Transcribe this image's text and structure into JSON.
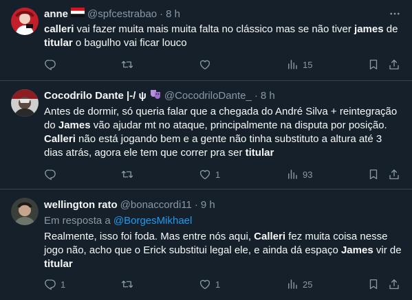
{
  "tweets": [
    {
      "name": "anne",
      "handle": "@spfcestrabao",
      "sep": "·",
      "time": "8 h",
      "text_parts": [
        {
          "t": "calleri",
          "b": true
        },
        {
          "t": " vai fazer muita mais muita falta no clássico mas se não tiver ",
          "b": false
        },
        {
          "t": "james",
          "b": true
        },
        {
          "t": " de ",
          "b": false
        },
        {
          "t": "titular",
          "b": true
        },
        {
          "t": " o bagulho vai ficar louco",
          "b": false
        }
      ],
      "replies": "",
      "retweets": "",
      "likes": "",
      "views": "15"
    },
    {
      "name": "Cocodrilo Dante |-/ ψ",
      "handle": "@CocodriloDante_",
      "sep": "·",
      "time": "8 h",
      "text_parts": [
        {
          "t": "Antes de dormir, só queria falar que a chegada do André Silva + reintegração do ",
          "b": false
        },
        {
          "t": "James",
          "b": true
        },
        {
          "t": " vão ajudar mt no ataque, principalmente na disputa por posição. ",
          "b": false
        },
        {
          "t": "Calleri",
          "b": true
        },
        {
          "t": " não está jogando bem e a gente não tinha substituto a altura até 3 dias atrás, agora ele tem que correr pra ser ",
          "b": false
        },
        {
          "t": "titular",
          "b": true
        }
      ],
      "replies": "",
      "retweets": "",
      "likes": "1",
      "views": "93"
    },
    {
      "name": "wellington rato",
      "handle": "@bonaccordi11",
      "sep": "·",
      "time": "9 h",
      "reply_prefix": "Em resposta a",
      "reply_to": "@BorgesMikhael",
      "text_parts": [
        {
          "t": "Realmente, isso foi foda. Mas entre nós aqui, ",
          "b": false
        },
        {
          "t": "Calleri",
          "b": true
        },
        {
          "t": " fez muita coisa nesse jogo não, acho que o Erick substitui legal ele, e ainda dá espaço ",
          "b": false
        },
        {
          "t": "James",
          "b": true
        },
        {
          "t": " vir de ",
          "b": false
        },
        {
          "t": "titular",
          "b": true
        }
      ],
      "replies": "1",
      "retweets": "",
      "likes": "1",
      "views": "25"
    }
  ],
  "colors": {
    "background": "#15202b",
    "text": "#f7f9f9",
    "muted": "#8b98a5",
    "link": "#1d9bf0",
    "divider": "#38444d"
  },
  "icons": [
    "reply-icon",
    "retweet-icon",
    "like-icon",
    "views-icon",
    "bookmark-icon",
    "share-icon",
    "more-icon"
  ]
}
